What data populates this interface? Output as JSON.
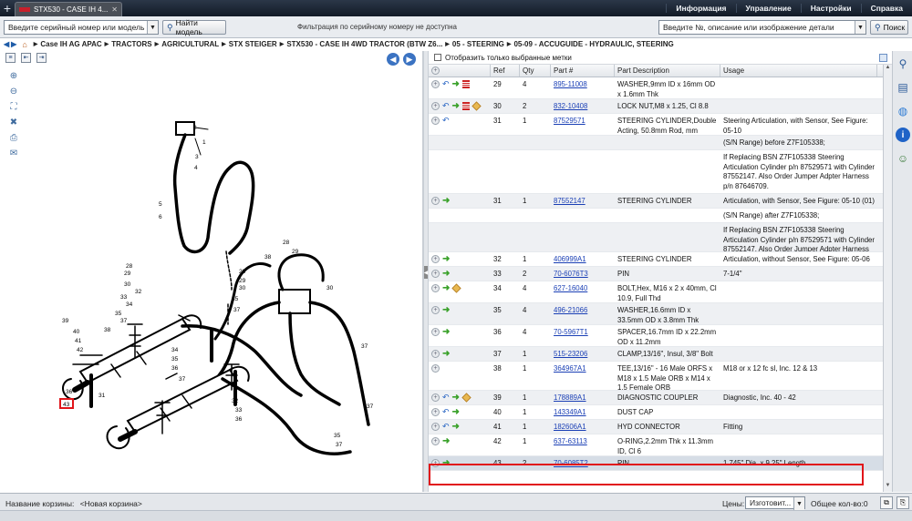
{
  "window": {
    "tab_title": "STX530 - CASE IH 4...",
    "new_tab": "+"
  },
  "topnav": [
    "Информация",
    "Управление",
    "Настройки",
    "Справка"
  ],
  "toolbar": {
    "serial_placeholder": "Введите серийный номер или модель",
    "find_model": "Найти модель",
    "filter_msg": "Фильтрация по серийному номеру не доступна",
    "part_search_placeholder": "Введите №, описание или изображение детали",
    "search": "Поиск"
  },
  "breadcrumb": [
    "Case IH AG APAC",
    "TRACTORS",
    "AGRICULTURAL",
    "STX STEIGER",
    "STX530 - CASE IH 4WD TRACTOR (BTW Z6...",
    "05 - STEERING",
    "05-09 - ACCUGUIDE - HYDRAULIC, STEERING"
  ],
  "diagram": {
    "callouts": [
      "1",
      "2",
      "3",
      "4",
      "5",
      "6",
      "28",
      "29",
      "30",
      "31",
      "32",
      "33",
      "34",
      "35",
      "36",
      "37",
      "38",
      "39",
      "40",
      "41",
      "42",
      "43"
    ],
    "highlighted_callout": "43"
  },
  "parts_table": {
    "show_selected_label": "Отобразить только выбранные метки",
    "columns": [
      "Ref",
      "Qty",
      "Part #",
      "Part Description",
      "Usage"
    ],
    "rows": [
      {
        "ref": "29",
        "qty": "4",
        "part": "895-11008",
        "desc": "WASHER,9mm ID x 16mm OD x 1.6mm Thk",
        "usage": "",
        "icons": [
          "back",
          "go",
          "doc"
        ]
      },
      {
        "ref": "30",
        "qty": "2",
        "part": "832-10408",
        "desc": "LOCK NUT,M8 x 1.25, Cl 8.8",
        "usage": "",
        "icons": [
          "back",
          "go",
          "doc",
          "box"
        ]
      },
      {
        "ref": "31",
        "qty": "1",
        "part": "87529571",
        "desc": "STEERING CYLINDER,Double Acting, 50.8mm Rod, mm Stroke",
        "usage": "Steering Articulation, with Sensor, See Figure: 05-10",
        "icons": [
          "back"
        ]
      },
      {
        "ref": "",
        "qty": "",
        "part": "",
        "desc": "",
        "usage": "(S/N Range) before Z7F105338;",
        "icons": []
      },
      {
        "ref": "",
        "qty": "",
        "part": "",
        "desc": "",
        "usage": "If Replacing BSN Z7F105338 Steering Articulation Cylinder p/n 87529571 with Cylinder 87552147. Also Order Jumper Adpter Harness p/n 87646709.",
        "icons": []
      },
      {
        "ref": "31",
        "qty": "1",
        "part": "87552147",
        "desc": "STEERING CYLINDER",
        "usage": "Articulation, with Sensor, See Figure: 05-10 (01)",
        "icons": [
          "go"
        ]
      },
      {
        "ref": "",
        "qty": "",
        "part": "",
        "desc": "",
        "usage": "(S/N Range) after Z7F105338;",
        "icons": []
      },
      {
        "ref": "",
        "qty": "",
        "part": "",
        "desc": "",
        "usage": "If Replacing BSN Z7F105338 Steering Articulation Cylinder p/n 87529571 with Cylinder 87552147. Also Order Jumper Adpter Harness p/n 87646709.",
        "icons": []
      },
      {
        "ref": "32",
        "qty": "1",
        "part": "406999A1",
        "desc": "STEERING CYLINDER",
        "usage": "Articulation, without Sensor, See Figure: 05-06",
        "icons": [
          "go"
        ]
      },
      {
        "ref": "33",
        "qty": "2",
        "part": "70-6076T3",
        "desc": "PIN",
        "usage": "7-1/4\"",
        "icons": [
          "go"
        ]
      },
      {
        "ref": "34",
        "qty": "4",
        "part": "627-16040",
        "desc": "BOLT,Hex, M16 x 2 x 40mm, Cl 10.9, Full Thd",
        "usage": "",
        "icons": [
          "go",
          "box"
        ]
      },
      {
        "ref": "35",
        "qty": "4",
        "part": "496-21066",
        "desc": "WASHER,16.6mm ID x 33.5mm OD x 3.8mm Thk",
        "usage": "",
        "icons": [
          "go"
        ]
      },
      {
        "ref": "36",
        "qty": "4",
        "part": "70-5967T1",
        "desc": "SPACER,16.7mm ID x 22.2mm OD x 11.2mm",
        "usage": "",
        "icons": [
          "go"
        ]
      },
      {
        "ref": "37",
        "qty": "1",
        "part": "515-23206",
        "desc": "CLAMP,13/16\", Insul, 3/8\" Bolt",
        "usage": "",
        "icons": [
          "go"
        ]
      },
      {
        "ref": "38",
        "qty": "1",
        "part": "364967A1",
        "desc": "TEE,13/16\" - 16 Male ORFS x M18 x 1.5 Male ORB x M14 x 1.5 Female ORB",
        "usage": "M18 or x 12 fc sl, Inc. 12 & 13",
        "icons": []
      },
      {
        "ref": "39",
        "qty": "1",
        "part": "178889A1",
        "desc": "DIAGNOSTIC COUPLER",
        "usage": "Diagnostic, Inc. 40 - 42",
        "icons": [
          "back",
          "go",
          "box"
        ]
      },
      {
        "ref": "40",
        "qty": "1",
        "part": "143349A1",
        "desc": "DUST CAP",
        "usage": "",
        "icons": [
          "back",
          "go"
        ]
      },
      {
        "ref": "41",
        "qty": "1",
        "part": "182606A1",
        "desc": "HYD CONNECTOR",
        "usage": "Fitting",
        "icons": [
          "back",
          "go"
        ]
      },
      {
        "ref": "42",
        "qty": "1",
        "part": "637-63113",
        "desc": "O-RING,2.2mm Thk x 11.3mm ID, Cl 6",
        "usage": "",
        "icons": [
          "go"
        ]
      },
      {
        "ref": "43",
        "qty": "2",
        "part": "70-6085T2",
        "desc": "PIN",
        "usage": "1.745\" Dia. x 9.25\" Length",
        "icons": [
          "go"
        ]
      }
    ]
  },
  "bottom": {
    "cart_label": "Название корзины:",
    "cart_name": "<Новая корзина>",
    "prices_label": "Цены:",
    "prices_value": "Изготовит...",
    "total_label": "Общее кол-во:",
    "total_value": "0"
  },
  "colors": {
    "highlight": "#e1151a",
    "link": "#1a3fb5",
    "topbar": "#1b2534"
  }
}
